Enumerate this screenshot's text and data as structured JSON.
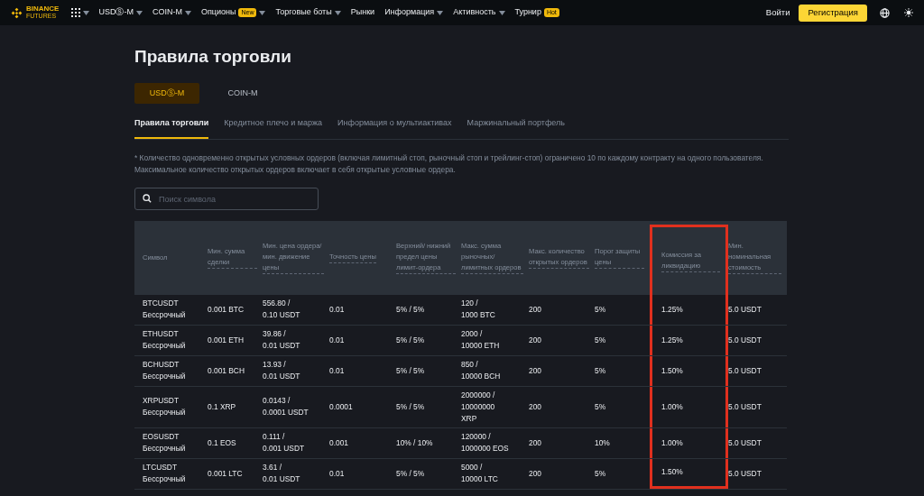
{
  "nav": {
    "logo_top": "BINANCE",
    "logo_bottom": "FUTURES",
    "items": [
      {
        "label": "USDⓈ-M",
        "caret": true
      },
      {
        "label": "COIN-M",
        "caret": true
      },
      {
        "label": "Опционы",
        "badge": "New",
        "caret": true
      },
      {
        "label": "Торговые боты",
        "caret": true
      },
      {
        "label": "Рынки",
        "caret": false
      },
      {
        "label": "Информация",
        "caret": true
      },
      {
        "label": "Активность",
        "caret": true
      },
      {
        "label": "Турнир",
        "badge": "Hot",
        "caret": false
      }
    ],
    "login": "Войти",
    "register": "Регистрация"
  },
  "title": "Правила торговли",
  "market_tabs": [
    {
      "label": "USDⓈ-M",
      "selected": true
    },
    {
      "label": "COIN-M",
      "selected": false
    }
  ],
  "sub_tabs": [
    {
      "label": "Правила торговли",
      "selected": true
    },
    {
      "label": "Кредитное плечо и маржа",
      "selected": false
    },
    {
      "label": "Информация о мультиактивах",
      "selected": false
    },
    {
      "label": "Маржинальный портфель",
      "selected": false
    }
  ],
  "note": "* Количество одновременно открытых условных ордеров (включая лимитный стоп, рыночный стоп и трейлинг-стоп) ограничено 10 по каждому контракту на одного пользователя. Максимальное количество открытых ордеров включает в себя открытые условные ордера.",
  "search": {
    "placeholder": "Поиск символа"
  },
  "table": {
    "columns": [
      {
        "label": "Символ",
        "highlighted": false
      },
      {
        "label": "Мин. сумма сделки",
        "highlighted": false
      },
      {
        "label": "Мин. цена ордера/мин. движение цены",
        "highlighted": false
      },
      {
        "label": "Точность цены",
        "highlighted": false
      },
      {
        "label": "Верхний/ нижний предел цены лимит-ордера",
        "highlighted": false
      },
      {
        "label": "Макс. сумма рыночных/ лимитных ордеров",
        "highlighted": false
      },
      {
        "label": "Макс. количество открытых ордеров",
        "highlighted": false
      },
      {
        "label": "Порог защиты цены",
        "highlighted": false
      },
      {
        "label": "Комиссия за ликвидацию",
        "highlighted": true
      },
      {
        "label": "Мин. номинальная стоимость",
        "highlighted": false
      }
    ],
    "rows": [
      [
        "BTCUSDT\nБессрочный",
        "0.001 BTC",
        "556.80 /\n0.10 USDT",
        "0.01",
        "5% / 5%",
        "120 /\n1000 BTC",
        "200",
        "5%",
        "1.25%",
        "5.0 USDT"
      ],
      [
        "ETHUSDT\nБессрочный",
        "0.001 ETH",
        "39.86 /\n0.01 USDT",
        "0.01",
        "5% / 5%",
        "2000 /\n10000 ETH",
        "200",
        "5%",
        "1.25%",
        "5.0 USDT"
      ],
      [
        "BCHUSDT\nБессрочный",
        "0.001 BCH",
        "13.93 /\n0.01 USDT",
        "0.01",
        "5% / 5%",
        "850 /\n10000 BCH",
        "200",
        "5%",
        "1.50%",
        "5.0 USDT"
      ],
      [
        "XRPUSDT\nБессрочный",
        "0.1 XRP",
        "0.0143 /\n0.0001 USDT",
        "0.0001",
        "5% / 5%",
        "2000000 /\n10000000\nXRP",
        "200",
        "5%",
        "1.00%",
        "5.0 USDT"
      ],
      [
        "EOSUSDT\nБессрочный",
        "0.1 EOS",
        "0.111 /\n0.001 USDT",
        "0.001",
        "10% / 10%",
        "120000 /\n1000000 EOS",
        "200",
        "10%",
        "1.00%",
        "5.0 USDT"
      ],
      [
        "LTCUSDT\nБессрочный",
        "0.001 LTC",
        "3.61 /\n0.01 USDT",
        "0.01",
        "5% / 5%",
        "5000 /\n10000 LTC",
        "200",
        "5%",
        "1.50%",
        "5.0 USDT"
      ]
    ]
  }
}
